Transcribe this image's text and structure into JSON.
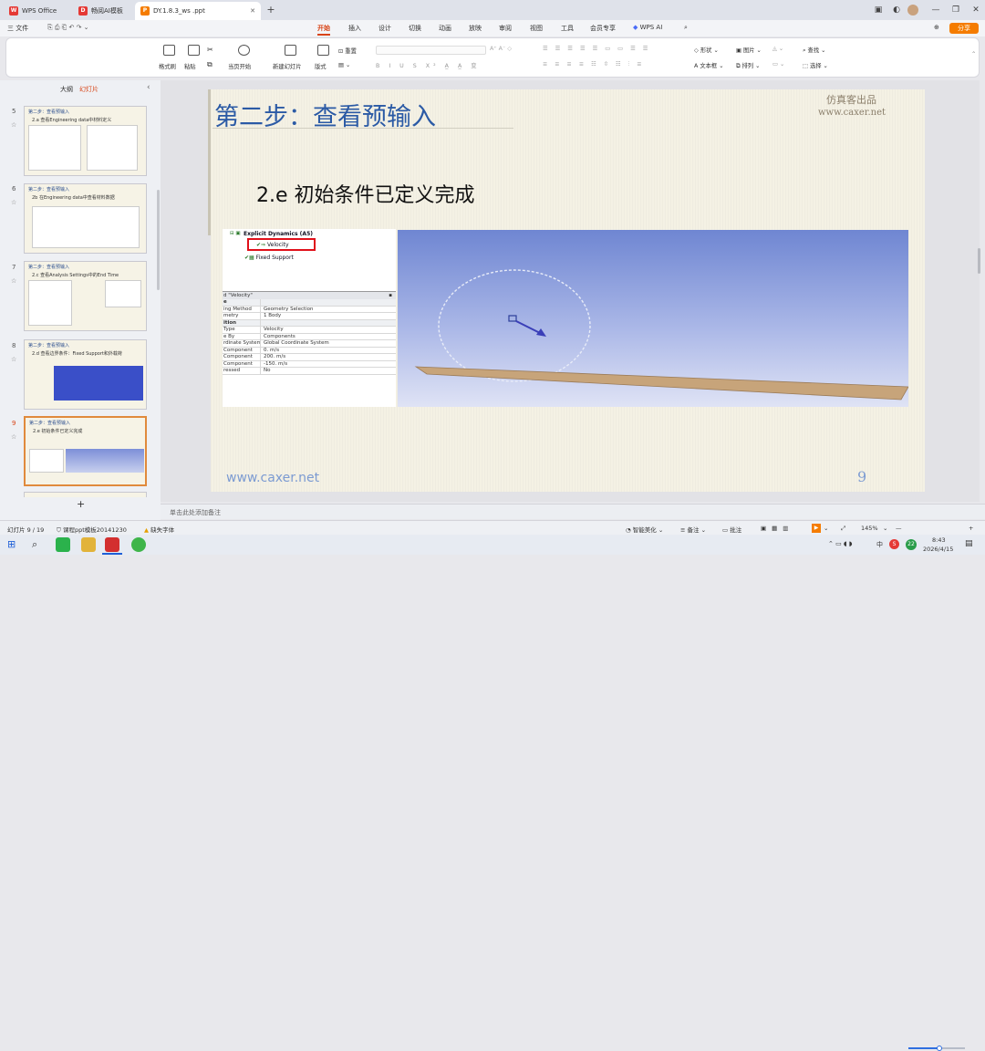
{
  "tabs": [
    {
      "label": "WPS Office",
      "logo": "W"
    },
    {
      "label": "畅阅AI模板",
      "logo": "D"
    },
    {
      "label": "DY.1.8.3_ws .ppt",
      "logo": "P"
    }
  ],
  "window_controls": {
    "add_tab": "+",
    "share_label": "分享"
  },
  "menu": {
    "file": "三 文件",
    "items": [
      "开始",
      "插入",
      "设计",
      "切换",
      "动画",
      "放映",
      "审阅",
      "视图",
      "工具",
      "会员专享"
    ],
    "ai": "WPS AI",
    "active": "开始"
  },
  "ribbon": {
    "format_painter": "格式刷",
    "paste": "粘贴",
    "play_current": "当页开始",
    "new_slide": "新建幻灯片",
    "layout": "版式",
    "reset": "重置",
    "shape": "形状",
    "image": "图片",
    "textbox": "文本框",
    "arrange": "排列",
    "find": "查找",
    "select": "选择"
  },
  "sidebar": {
    "tab_outline": "大纲",
    "tab_slides": "幻灯片",
    "thumbs": [
      {
        "num": "5",
        "title": "第二步：查看预输入",
        "sub": "2.a 查看Engineering data中材料定义"
      },
      {
        "num": "6",
        "title": "第二步：查看预输入",
        "sub": "2b 在Engineering data中查看材料数据"
      },
      {
        "num": "7",
        "title": "第二步：查看预输入",
        "sub": "2.c 查看Analysis Settings中的End Time"
      },
      {
        "num": "8",
        "title": "第二步：查看预输入",
        "sub": "2.d 查看边界条件：Fixed Support和外载荷"
      },
      {
        "num": "9",
        "title": "第二步：查看预输入",
        "sub": "2.e 初始条件已定义完成"
      }
    ],
    "add_label": "+"
  },
  "slide": {
    "title": "第二步：查看预输入",
    "brand_line1": "仿真客出品",
    "brand_line2": "www.caxer.net",
    "subtitle": "2.e  初始条件已定义完成",
    "url": "www.caxer.net",
    "page": "9"
  },
  "ansys": {
    "tree_root": "Explicit Dynamics (A5)",
    "tree_velocity": "Velocity",
    "tree_fixed": "Fixed Support",
    "details_title": "d \"Velocity\"",
    "rows": [
      [
        "e",
        ""
      ],
      [
        "ing Method",
        "Geometry Selection"
      ],
      [
        "metry",
        "1 Body"
      ],
      [
        "ition",
        ""
      ],
      [
        "Type",
        "Velocity"
      ],
      [
        "e By",
        "Components"
      ],
      [
        "rdinate System",
        "Global Coordinate System"
      ],
      [
        "Component",
        "0. m/s"
      ],
      [
        "Component",
        "200. m/s"
      ],
      [
        "Component",
        "-150. m/s"
      ],
      [
        "ressed",
        "No"
      ]
    ]
  },
  "notes_placeholder": "单击此处添加备注",
  "status": {
    "slide_counter": "幻灯片 9 / 19",
    "template": "课程ppt模板20141230",
    "missing_font": "缺失字体",
    "smart_beautify": "智能美化",
    "notes": "备注",
    "comments": "批注",
    "zoom": "145%"
  },
  "taskbar": {
    "time": "8:43",
    "date": "2026/4/15",
    "lang": "中",
    "temp_badge": "22"
  }
}
